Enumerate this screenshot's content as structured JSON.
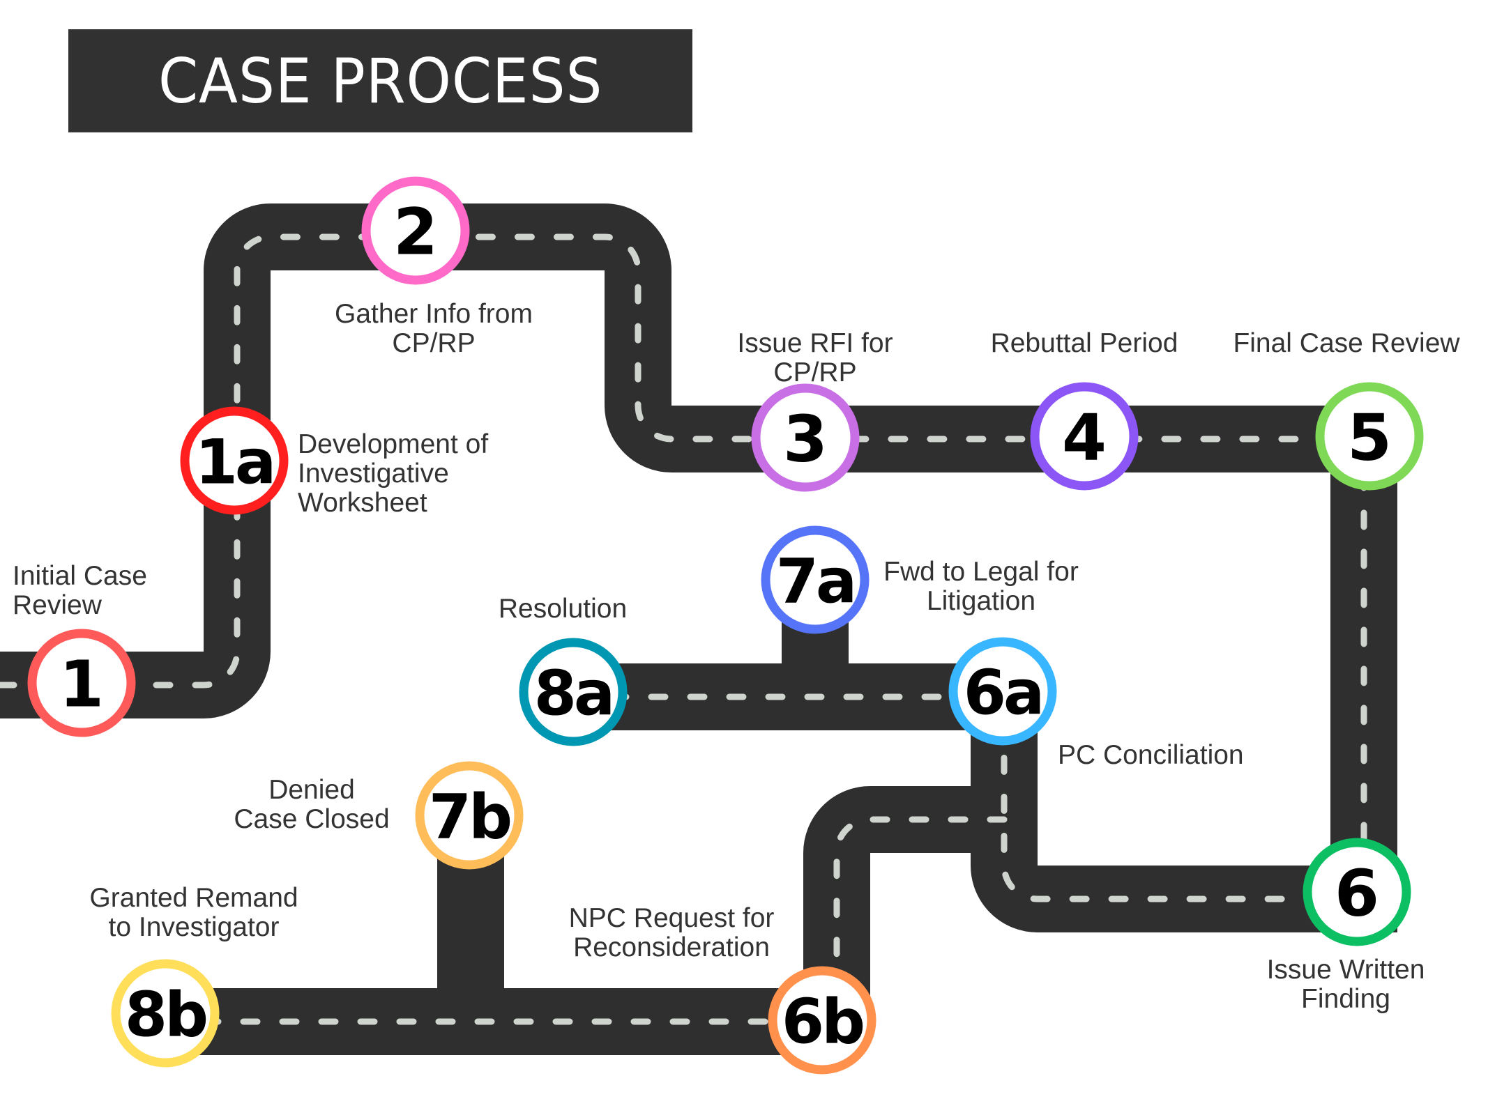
{
  "title": "CASE PROCESS",
  "colors": {
    "road": "#2f2f2f",
    "lane_marking": "#cfd5ce",
    "label_text": "#333333",
    "title_bg": "#313131",
    "title_text": "#ffffff"
  },
  "steps": [
    {
      "id": "1",
      "label_lines": [
        "Initial Case",
        "Review"
      ],
      "ring_color": "#ff5a5a"
    },
    {
      "id": "1a",
      "label_lines": [
        "Development of",
        "Investigative",
        "Worksheet"
      ],
      "ring_color": "#ff1f1f"
    },
    {
      "id": "2",
      "label_lines": [
        "Gather Info from",
        "CP/RP"
      ],
      "ring_color": "#ff6ac8"
    },
    {
      "id": "3",
      "label_lines": [
        "Issue RFI for",
        "CP/RP"
      ],
      "ring_color": "#c86fe6"
    },
    {
      "id": "4",
      "label_lines": [
        "Rebuttal Period"
      ],
      "ring_color": "#8c55f5"
    },
    {
      "id": "5",
      "label_lines": [
        "Final Case Review"
      ],
      "ring_color": "#7fd957"
    },
    {
      "id": "6",
      "label_lines": [
        "Issue Written",
        "Finding"
      ],
      "ring_color": "#0cbf62"
    },
    {
      "id": "6a",
      "label_lines": [
        "PC Conciliation"
      ],
      "ring_color": "#38b6ff"
    },
    {
      "id": "7a",
      "label_lines": [
        "Fwd to Legal for",
        "Litigation"
      ],
      "ring_color": "#5674f7"
    },
    {
      "id": "8a",
      "label_lines": [
        "Resolution"
      ],
      "ring_color": "#0097b2"
    },
    {
      "id": "6b",
      "label_lines": [
        "NPC Request for",
        "Reconsideration"
      ],
      "ring_color": "#ff914d"
    },
    {
      "id": "7b",
      "label_lines": [
        "Denied",
        "Case Closed"
      ],
      "ring_color": "#ffbd59"
    },
    {
      "id": "8b",
      "label_lines": [
        "Granted Remand",
        "to Investigator"
      ],
      "ring_color": "#ffde59"
    }
  ]
}
